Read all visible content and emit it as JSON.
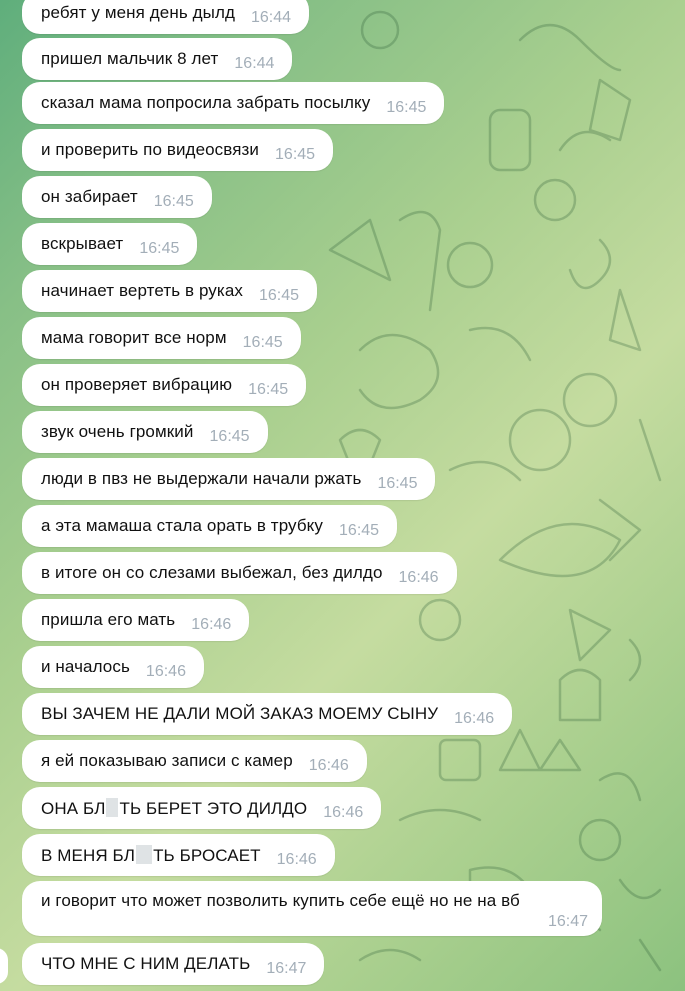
{
  "messages": [
    {
      "text": "ребят у меня день дылд",
      "time": "16:44"
    },
    {
      "text": "пришел мальчик 8 лет",
      "time": "16:44"
    },
    {
      "text": "сказал мама попросила забрать посылку",
      "time": "16:45"
    },
    {
      "text": "и проверить по видеосвязи",
      "time": "16:45"
    },
    {
      "text": "он забирает",
      "time": "16:45"
    },
    {
      "text": "вскрывает",
      "time": "16:45"
    },
    {
      "text": "начинает вертеть в руках",
      "time": "16:45"
    },
    {
      "text": "мама говорит все норм",
      "time": "16:45"
    },
    {
      "text": "он проверяет вибрацию",
      "time": "16:45"
    },
    {
      "text": "звук очень громкий",
      "time": "16:45"
    },
    {
      "text": "люди в пвз не выдержали начали ржать",
      "time": "16:45"
    },
    {
      "text": "а эта мамаша стала орать в трубку",
      "time": "16:45"
    },
    {
      "text": "в итоге он со слезами выбежал, без дилдо",
      "time": "16:46"
    },
    {
      "text": "пришла его мать",
      "time": "16:46"
    },
    {
      "text": "и началось",
      "time": "16:46"
    },
    {
      "text": "ВЫ ЗАЧЕМ НЕ ДАЛИ МОЙ ЗАКАЗ МОЕМУ СЫНУ",
      "time": "16:46"
    },
    {
      "text": "я ей показываю записи с камер",
      "time": "16:46"
    },
    {
      "text_a": "ОНА БЛ",
      "text_b": "ТЬ БЕРЕТ ЭТО ДИЛДО",
      "time": "16:46"
    },
    {
      "text_a": "В МЕНЯ БЛ",
      "text_b": "ТЬ БРОСАЕТ",
      "time": "16:46"
    },
    {
      "text": "и говорит что может позволить купить себе ещё но не на вб",
      "time": "16:47"
    },
    {
      "text": "ЧТО МНЕ С НИМ ДЕЛАТЬ",
      "time": "16:47"
    }
  ]
}
